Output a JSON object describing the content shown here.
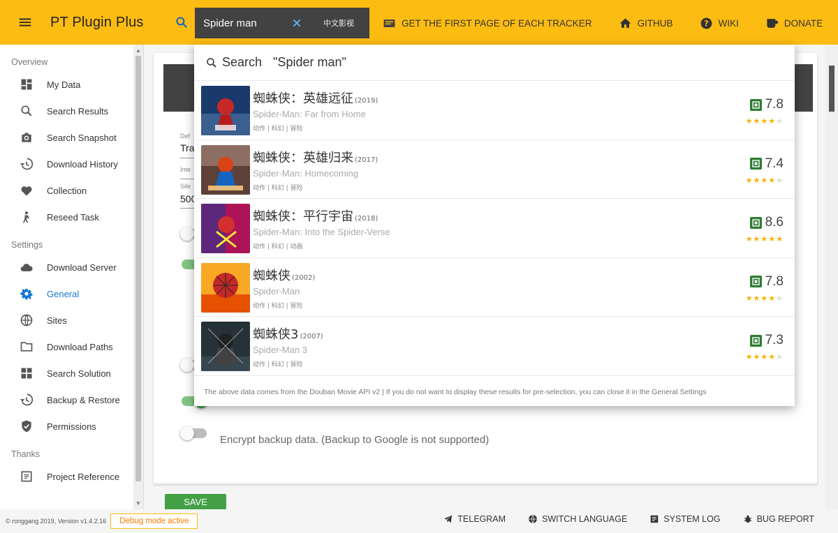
{
  "app": {
    "title": "PT Plugin Plus"
  },
  "search": {
    "value": "Spider man",
    "scope_label": "中文影视"
  },
  "nav": [
    {
      "label": "GET THE FIRST PAGE OF EACH TRACKER",
      "icon": "rss-feed-icon"
    },
    {
      "label": "GITHUB",
      "icon": "home-icon"
    },
    {
      "label": "WIKI",
      "icon": "help-icon"
    },
    {
      "label": "DONATE",
      "icon": "coffee-icon"
    }
  ],
  "sidebar": {
    "sections": [
      {
        "title": "Overview",
        "items": [
          {
            "label": "My Data",
            "icon": "dashboard-icon"
          },
          {
            "label": "Search Results",
            "icon": "search-icon"
          },
          {
            "label": "Search Snapshot",
            "icon": "camera-icon"
          },
          {
            "label": "Download History",
            "icon": "history-icon"
          },
          {
            "label": "Collection",
            "icon": "heart-icon"
          },
          {
            "label": "Reseed Task",
            "icon": "person-icon"
          }
        ]
      },
      {
        "title": "Settings",
        "items": [
          {
            "label": "Download Server",
            "icon": "cloud-icon"
          },
          {
            "label": "General",
            "icon": "gear-icon",
            "active": true
          },
          {
            "label": "Sites",
            "icon": "globe-icon"
          },
          {
            "label": "Download Paths",
            "icon": "folder-icon"
          },
          {
            "label": "Search Solution",
            "icon": "grid-icon"
          },
          {
            "label": "Backup & Restore",
            "icon": "restore-icon"
          },
          {
            "label": "Permissions",
            "icon": "shield-icon"
          }
        ]
      },
      {
        "title": "Thanks",
        "items": [
          {
            "label": "Project Reference",
            "icon": "reference-icon"
          }
        ]
      }
    ]
  },
  "dropdown": {
    "search_label": "Search",
    "query": "\"Spider man\"",
    "results": [
      {
        "title": "蜘蛛侠：英雄远征",
        "year": "(2019)",
        "subtitle": "Spider-Man: Far from Home",
        "genres": "动作 | 科幻 | 冒险",
        "rating": "7.8",
        "stars": 4
      },
      {
        "title": "蜘蛛侠：英雄归来",
        "year": "(2017)",
        "subtitle": "Spider-Man: Homecoming",
        "genres": "动作 | 科幻 | 冒险",
        "rating": "7.4",
        "stars": 4
      },
      {
        "title": "蜘蛛侠：平行宇宙",
        "year": "(2018)",
        "subtitle": "Spider-Man: Into the Spider-Verse",
        "genres": "动作 | 科幻 | 动画",
        "rating": "8.6",
        "stars": 5
      },
      {
        "title": "蜘蛛侠",
        "year": "(2002)",
        "subtitle": "Spider-Man",
        "genres": "动作 | 科幻 | 冒险",
        "rating": "7.8",
        "stars": 4
      },
      {
        "title": "蜘蛛侠3",
        "year": "(2007)",
        "subtitle": "Spider-Man 3",
        "genres": "动作 | 科幻 | 冒险",
        "rating": "7.3",
        "stars": 4
      }
    ],
    "footnote": "The above data comes from the Douban Movie API v2 | If you do not want to display these results for pre-selection, you can close it in the General Settings"
  },
  "content": {
    "field1_label": "Def",
    "field1_value": "Tra",
    "field2_label": "Inte",
    "field3_label": "Sile",
    "field3_value": "500",
    "encrypt_label": "Encrypt backup data. (Backup to Google is not supported)",
    "save_label": "SAVE"
  },
  "footer": {
    "copyright": "© ronggang 2019, Version v1.4.2.16",
    "debug_label": "Debug mode active",
    "links": [
      {
        "label": "TELEGRAM",
        "icon": "telegram-icon"
      },
      {
        "label": "SWITCH LANGUAGE",
        "icon": "language-icon"
      },
      {
        "label": "SYSTEM LOG",
        "icon": "log-icon"
      },
      {
        "label": "BUG REPORT",
        "icon": "bug-icon"
      }
    ]
  },
  "colors": {
    "accent": "#fdbc12",
    "active": "#1976d2",
    "switch_on": "#43a047",
    "douban": "#2e7d32",
    "star": "#f5b400"
  }
}
